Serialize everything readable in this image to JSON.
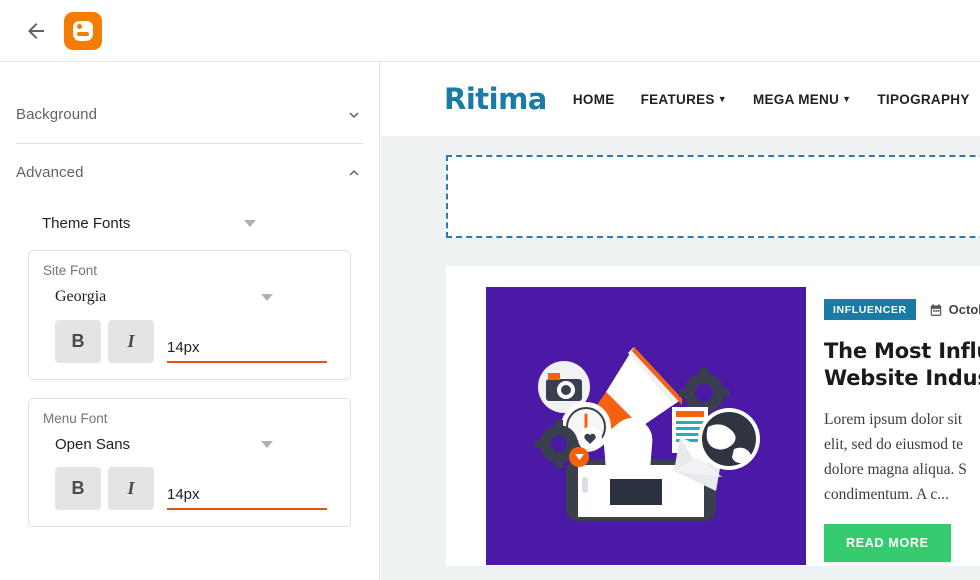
{
  "topbar": {
    "back_icon": "arrow-left-icon",
    "logo_icon": "blogger-logo-icon",
    "logo_color": "#f57c00"
  },
  "sidebar": {
    "sections": [
      {
        "label": "Background",
        "expanded": false,
        "chevron": "chevron-down-icon"
      },
      {
        "label": "Advanced",
        "expanded": true,
        "chevron": "chevron-up-icon"
      }
    ],
    "theme_fonts": {
      "label": "Theme Fonts",
      "caret_icon": "caret-down-icon"
    },
    "font_cards": [
      {
        "title": "Site Font",
        "family": "Georgia",
        "bold_label": "B",
        "italic_label": "I",
        "size": "14px",
        "underline_color": "#e8540c"
      },
      {
        "title": "Menu Font",
        "family": "Open Sans",
        "bold_label": "B",
        "italic_label": "I",
        "size": "14px",
        "underline_color": "#e8540c"
      }
    ]
  },
  "preview": {
    "background_color": "#eff2f3",
    "site": {
      "logo_text": "Ritima",
      "logo_color": "#1b7ba4",
      "nav": [
        {
          "label": "HOME",
          "has_caret": false
        },
        {
          "label": "FEATURES",
          "has_caret": true,
          "caret_icon": "chevron-down-icon"
        },
        {
          "label": "MEGA MENU",
          "has_caret": true,
          "caret_icon": "chevron-down-icon"
        },
        {
          "label": "TIPOGRAPHY",
          "has_caret": false
        }
      ]
    },
    "dropzone": {
      "name": "widget-dropzone",
      "border_color": "#2a7bb5"
    },
    "post": {
      "thumb_icon": "megaphone-illustration",
      "thumb_bg": "#4a19a5",
      "badge": "INFLUENCER",
      "badge_color": "#1b7ba4",
      "date_icon": "calendar-icon",
      "date": "Octobe",
      "title_line1": "The Most Influent",
      "title_line2": "Website Industry",
      "excerpt_line1": "Lorem ipsum dolor sit",
      "excerpt_line2": "elit, sed do eiusmod te",
      "excerpt_line3": "dolore magna aliqua. S",
      "excerpt_line4": "condimentum. A c...",
      "read_more": "READ MORE",
      "read_more_color": "#34cc6f"
    }
  }
}
